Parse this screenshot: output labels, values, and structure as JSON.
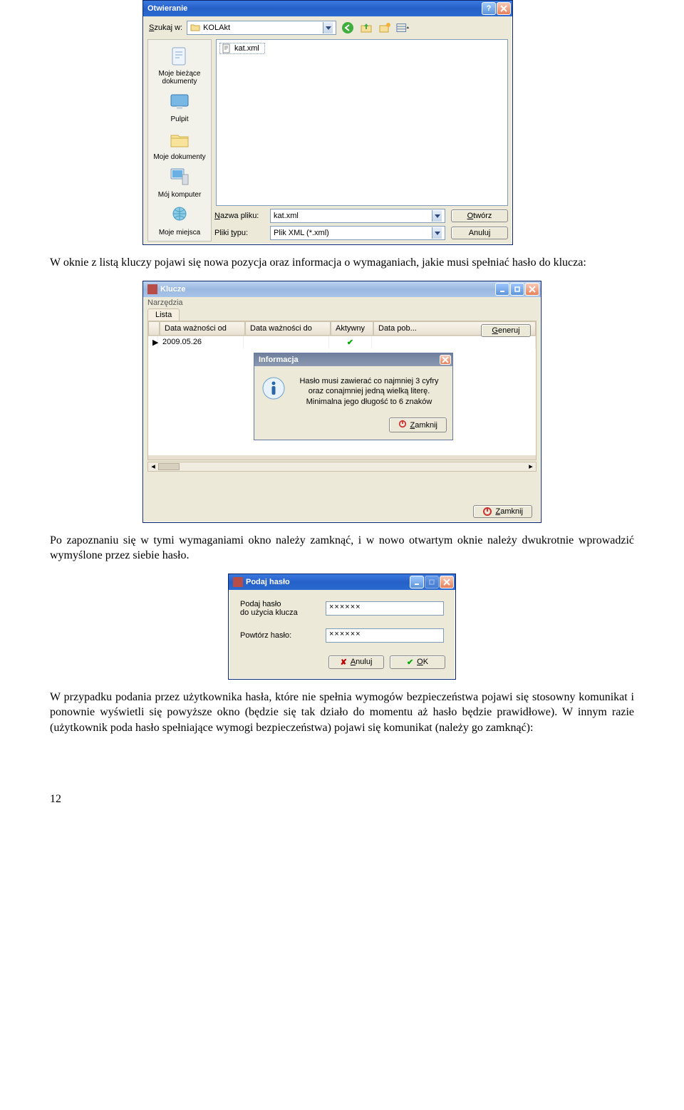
{
  "open_dlg": {
    "title": "Otwieranie",
    "lookin_label": "Szukaj w:",
    "lookin_value": "KOLAkt",
    "file_item": "kat.xml",
    "places": [
      {
        "label": "Moje bieżące dokumenty"
      },
      {
        "label": "Pulpit"
      },
      {
        "label": "Moje dokumenty"
      },
      {
        "label": "Mój komputer"
      },
      {
        "label": "Moje miejsca"
      }
    ],
    "fname_label": "Nazwa pliku:",
    "fname_hot": "N",
    "fname_value": "kat.xml",
    "ftype_label": "Pliki typu:",
    "ftype_hot": "t",
    "ftype_value": "Plik XML (*.xml)",
    "btn_open": "Otwórz",
    "btn_open_hot": "O",
    "btn_cancel": "Anuluj"
  },
  "para1": "W oknie z listą kluczy pojawi się nowa pozycja oraz informacja o wymaganiach, jakie musi spełniać hasło do klucza:",
  "klucze": {
    "title": "Klucze",
    "menu": "Narzędzia",
    "tab": "Lista",
    "cols": [
      "Data ważności od",
      "Data ważności do",
      "Aktywny",
      "Data pob..."
    ],
    "row_date": "2009.05.26",
    "btn_gen": "Generuj",
    "btn_gen_hot": "G",
    "btn_close": "Zamknij",
    "btn_close_hot": "Z",
    "info_title": "Informacja",
    "info_text": "Hasło musi zawierać co najmniej 3 cyfry oraz conajmniej jedną wielką literę. Minimalna jego długość to 6 znaków",
    "info_btn": "Zamknij",
    "info_btn_hot": "Z"
  },
  "para2": "Po zapoznaniu się w tymi wymaganiami okno należy zamknąć, i w nowo otwartym oknie należy dwukrotnie wprowadzić wymyślone przez siebie hasło.",
  "pass": {
    "title": "Podaj hasło",
    "lbl1a": "Podaj hasło",
    "lbl1b": "do użycia klucza",
    "lbl2": "Powtórz hasło:",
    "val": "××××××",
    "btn_cancel": "Anuluj",
    "btn_cancel_hot": "A",
    "btn_ok": "OK",
    "btn_ok_hot": "O"
  },
  "para3": "W przypadku podania przez użytkownika hasła, które nie spełnia wymogów bezpieczeństwa pojawi się stosowny komunikat i ponownie wyświetli się powyższe okno (będzie się tak działo do momentu aż hasło będzie prawidłowe). W innym razie (użytkownik poda hasło spełniające wymogi bezpieczeństwa) pojawi się komunikat (należy go zamknąć):",
  "pagenum": "12"
}
